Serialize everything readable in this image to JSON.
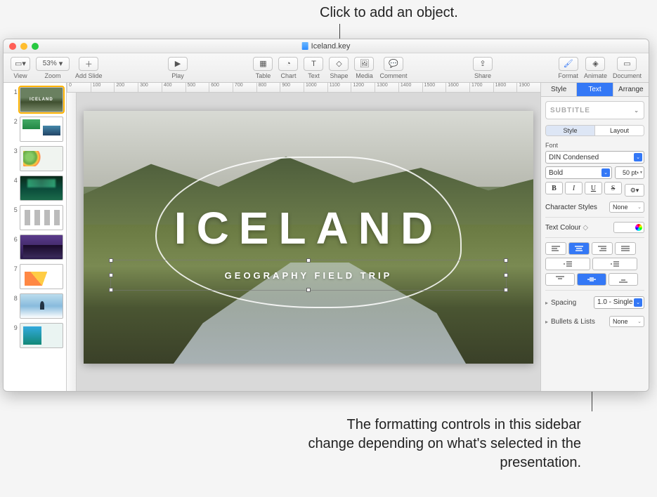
{
  "annotations": {
    "top": "Click to add an object.",
    "bottom": "The formatting controls in this sidebar change depending on what's selected in the presentation."
  },
  "titlebar": {
    "filename": "Iceland.key"
  },
  "toolbar": {
    "view": "View",
    "zoom_value": "53%",
    "zoom": "Zoom",
    "add_slide": "Add Slide",
    "play": "Play",
    "table": "Table",
    "chart": "Chart",
    "text": "Text",
    "shape": "Shape",
    "media": "Media",
    "comment": "Comment",
    "share": "Share",
    "format": "Format",
    "animate": "Animate",
    "document": "Document"
  },
  "ruler_ticks": [
    "0",
    "100",
    "200",
    "300",
    "400",
    "500",
    "600",
    "700",
    "800",
    "900",
    "1000",
    "1100",
    "1200",
    "1300",
    "1400",
    "1500",
    "1600",
    "1700",
    "1800",
    "1900"
  ],
  "thumbs": [
    {
      "num": "1"
    },
    {
      "num": "2"
    },
    {
      "num": "3"
    },
    {
      "num": "4"
    },
    {
      "num": "5"
    },
    {
      "num": "6"
    },
    {
      "num": "7"
    },
    {
      "num": "8"
    },
    {
      "num": "9"
    }
  ],
  "slide": {
    "title": "ICELAND",
    "subtitle": "GEOGRAPHY FIELD TRIP"
  },
  "inspector": {
    "tabs": {
      "style": "Style",
      "text": "Text",
      "arrange": "Arrange"
    },
    "preset": "SUBTITLE",
    "sub_tabs": {
      "style": "Style",
      "layout": "Layout"
    },
    "font_label": "Font",
    "font_family": "DIN Condensed",
    "font_weight": "Bold",
    "font_size": "50 pt",
    "b": "B",
    "i": "I",
    "u": "U",
    "s": "S",
    "char_styles": "Character Styles",
    "char_styles_val": "None",
    "text_colour": "Text Colour",
    "spacing": "Spacing",
    "spacing_val": "1.0 - Single",
    "bullets": "Bullets & Lists",
    "bullets_val": "None"
  }
}
